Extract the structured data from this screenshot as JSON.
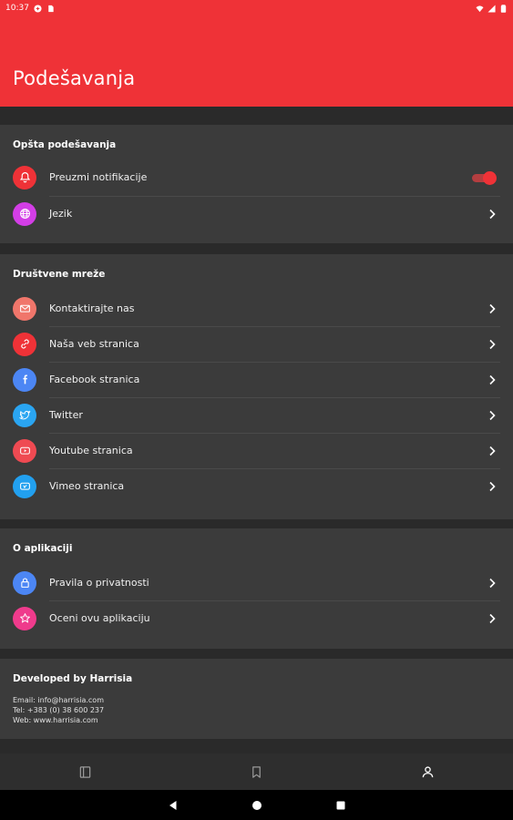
{
  "status_bar": {
    "time": "10:37"
  },
  "header": {
    "title": "Podešavanja"
  },
  "sections": {
    "general": {
      "title": "Opšta podešavanja",
      "items": [
        {
          "label": "Preuzmi notifikacije",
          "icon": "bell-icon",
          "color": "#ef3237",
          "control": "toggle",
          "on": true
        },
        {
          "label": "Jezik",
          "icon": "globe-icon",
          "color": "#d33ee6",
          "control": "chevron"
        }
      ]
    },
    "social": {
      "title": "Društvene mreže",
      "items": [
        {
          "label": "Kontaktirajte nas",
          "icon": "mail-icon",
          "color": "#f0766b"
        },
        {
          "label": "Naša veb stranica",
          "icon": "link-icon",
          "color": "#ef3237"
        },
        {
          "label": "Facebook stranica",
          "icon": "facebook-icon",
          "color": "#4c86f4"
        },
        {
          "label": "Twitter",
          "icon": "twitter-icon",
          "color": "#2aa5f1"
        },
        {
          "label": "Youtube stranica",
          "icon": "youtube-icon",
          "color": "#ef4a52"
        },
        {
          "label": "Vimeo stranica",
          "icon": "vimeo-icon",
          "color": "#22a0ef"
        }
      ]
    },
    "about": {
      "title": "O aplikaciji",
      "items": [
        {
          "label": "Pravila o privatnosti",
          "icon": "lock-icon",
          "color": "#4c86f4"
        },
        {
          "label": "Oceni ovu aplikaciju",
          "icon": "star-icon",
          "color": "#ef3b8c"
        }
      ]
    },
    "developer": {
      "title": "Developed by Harrisia",
      "email": "Email: info@harrisia.com",
      "tel": "Tel: +383 (0) 38 600 237",
      "web": "Web: www.harrisia.com"
    }
  },
  "bottom_nav": {
    "items": [
      {
        "name": "home-icon",
        "active": false
      },
      {
        "name": "bookmark-icon",
        "active": false
      },
      {
        "name": "profile-icon",
        "active": true
      }
    ]
  },
  "colors": {
    "accent": "#ef3237",
    "background": "#2a2a2a",
    "card": "#3b3b3b"
  }
}
